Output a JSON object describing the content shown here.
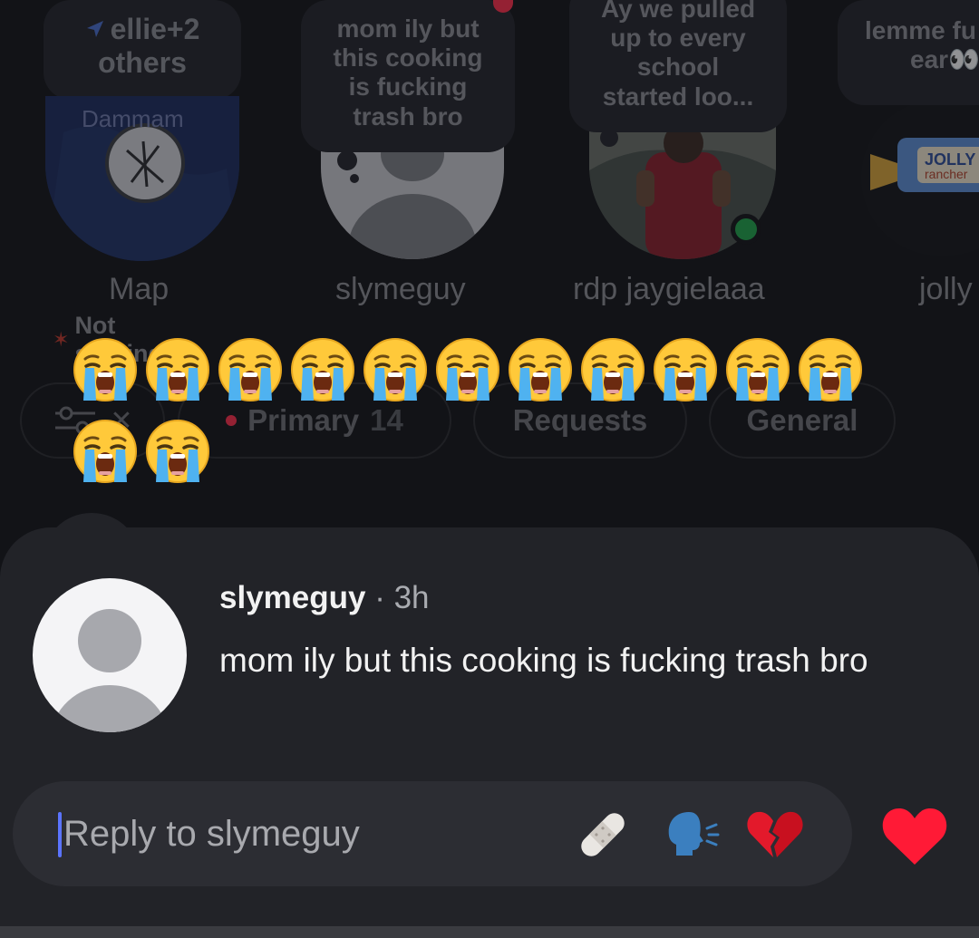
{
  "notes": [
    {
      "bubble_line1": "ellie+2",
      "bubble_line2": "others",
      "map_label": "Dammam",
      "name": "Map",
      "status": "Not sharing"
    },
    {
      "bubble_lines": [
        "mom ily but",
        "this cooking",
        "is fucking",
        "trash bro"
      ],
      "name": "slymeguy"
    },
    {
      "bubble_lines": [
        "Ay we pulled",
        "up to every",
        "school",
        "started loo..."
      ],
      "name": "rdp jaygielaaa"
    },
    {
      "bubble_lines": [
        "lemme fu",
        "ear👀"
      ],
      "avatar_brand": "JOLLY",
      "avatar_brand_sub": "rancher",
      "name": "jolly"
    }
  ],
  "tabs": [
    {
      "label": "Primary",
      "count": "14"
    },
    {
      "label": "Requests"
    },
    {
      "label": "General"
    }
  ],
  "emoji_icon": "loudly-crying-face-emoji",
  "emoji_rows": [
    11,
    2
  ],
  "reply_sheet": {
    "username": "slymeguy",
    "separator": "·",
    "time": "3h",
    "message": "mom ily but this cooking is fucking trash bro",
    "reply_placeholder": "Reply to slymeguy",
    "quick_emojis": [
      "bandage-emoji",
      "speaking-head-emoji",
      "broken-heart-emoji"
    ],
    "like_icon": "heart-icon"
  },
  "colors": {
    "background": "#121317",
    "sheet": "#222328",
    "accent_caret": "#5b74ff",
    "like": "#ff1a36"
  }
}
